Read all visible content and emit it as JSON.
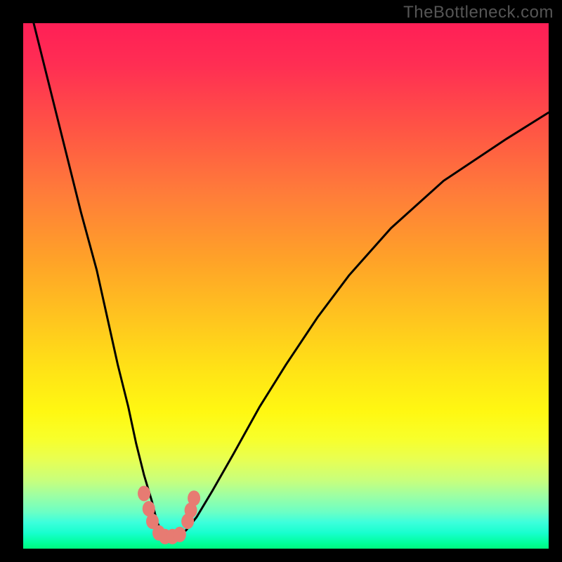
{
  "watermark": "TheBottleneck.com",
  "chart_data": {
    "type": "line",
    "title": "",
    "xlabel": "",
    "ylabel": "",
    "xlim": [
      0,
      100
    ],
    "ylim": [
      0,
      100
    ],
    "background": "red-yellow-green vertical gradient (bottleneck heat)",
    "series": [
      {
        "name": "bottleneck-curve",
        "x": [
          2,
          5,
          8,
          11,
          14,
          16,
          18,
          20,
          21.5,
          23,
          24.5,
          25.5,
          26.5,
          27.5,
          29,
          31,
          33,
          36,
          40,
          45,
          50,
          56,
          62,
          70,
          80,
          92,
          100
        ],
        "y": [
          100,
          88,
          76,
          64,
          53,
          44,
          35,
          27,
          20,
          14,
          9,
          5,
          3,
          2.2,
          2.2,
          3.5,
          6,
          11,
          18,
          27,
          35,
          44,
          52,
          61,
          70,
          78,
          83
        ]
      }
    ],
    "markers": [
      {
        "name": "left-cluster-upper",
        "x": 23.0,
        "y": 10.5
      },
      {
        "name": "left-cluster-mid",
        "x": 23.9,
        "y": 7.6
      },
      {
        "name": "left-cluster-low",
        "x": 24.6,
        "y": 5.2
      },
      {
        "name": "bottom-a",
        "x": 25.8,
        "y": 3.0
      },
      {
        "name": "bottom-b",
        "x": 27.0,
        "y": 2.3
      },
      {
        "name": "bottom-c",
        "x": 28.4,
        "y": 2.3
      },
      {
        "name": "bottom-d",
        "x": 29.8,
        "y": 2.7
      },
      {
        "name": "right-cluster-low",
        "x": 31.3,
        "y": 5.2
      },
      {
        "name": "right-cluster-mid",
        "x": 31.9,
        "y": 7.3
      },
      {
        "name": "right-cluster-upper",
        "x": 32.5,
        "y": 9.6
      }
    ],
    "colors": {
      "curve": "#000000",
      "marker": "#e77b72"
    }
  }
}
